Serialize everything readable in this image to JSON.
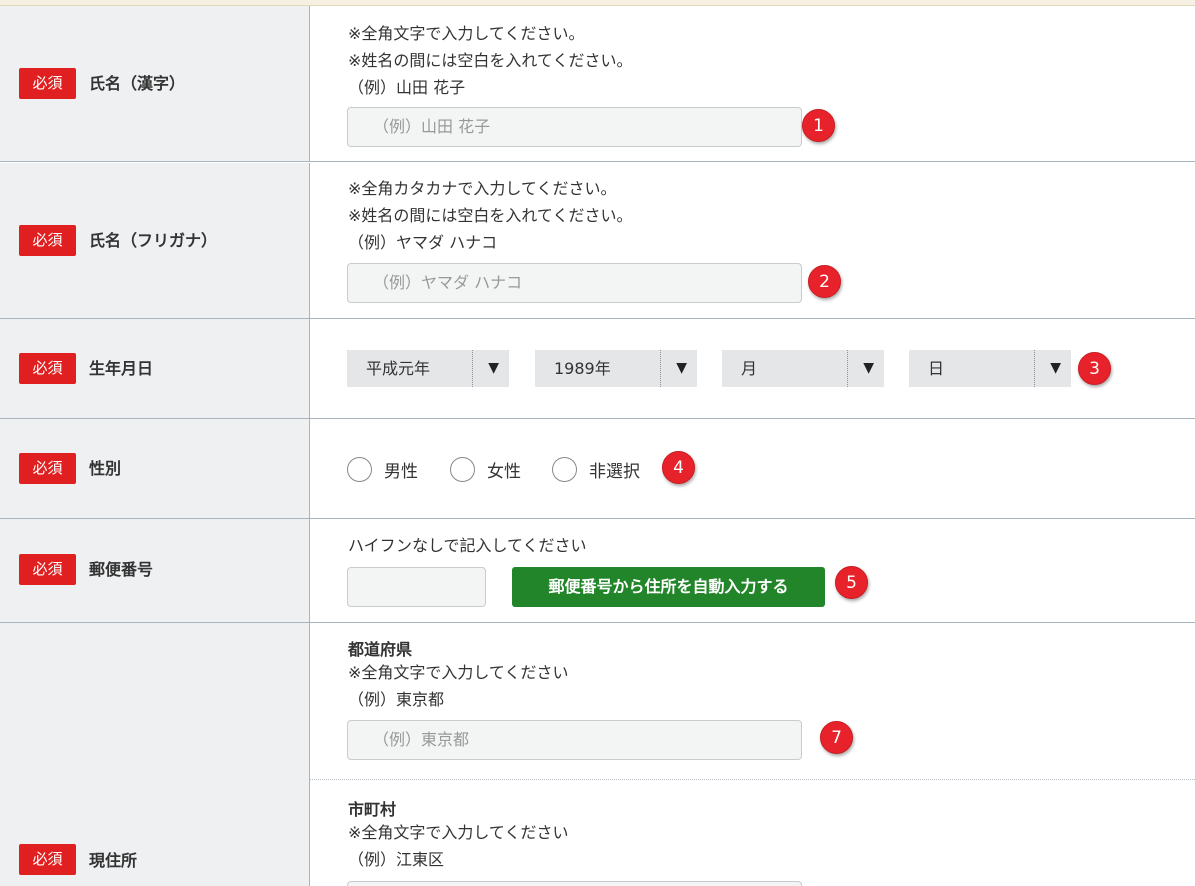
{
  "required_label": "必須",
  "name_kanji": {
    "label": "氏名（漢字）",
    "notes": [
      "※全角文字で入力してください。",
      "※姓名の間には空白を入れてください。",
      "（例）山田 花子"
    ],
    "placeholder": "（例）山田 花子",
    "badge": "1"
  },
  "name_kana": {
    "label": "氏名（フリガナ）",
    "notes": [
      "※全角カタカナで入力してください。",
      "※姓名の間には空白を入れてください。",
      "（例）ヤマダ ハナコ"
    ],
    "placeholder": "（例）ヤマダ ハナコ",
    "badge": "2"
  },
  "birthdate": {
    "label": "生年月日",
    "era": "平成元年",
    "year": "1989年",
    "month": "月",
    "day": "日",
    "arrow": "▼",
    "badge": "3"
  },
  "gender": {
    "label": "性別",
    "options": [
      "男性",
      "女性",
      "非選択"
    ],
    "badge": "4"
  },
  "postal": {
    "label": "郵便番号",
    "note": "ハイフンなしで記入してください",
    "button": "郵便番号から住所を自動入力する",
    "badge": "5"
  },
  "address": {
    "label": "現住所",
    "prefecture": {
      "title": "都道府県",
      "notes": [
        "※全角文字で入力してください",
        "（例）東京都"
      ],
      "placeholder": "（例）東京都",
      "badge": "7"
    },
    "city": {
      "title": "市町村",
      "notes": [
        "※全角文字で入力してください",
        "（例）江東区"
      ]
    }
  },
  "colors": {
    "required_bg": "#e02020",
    "badge_bg": "#e8222a",
    "button_bg": "#22852a",
    "label_cell_bg": "#eff0f2"
  }
}
